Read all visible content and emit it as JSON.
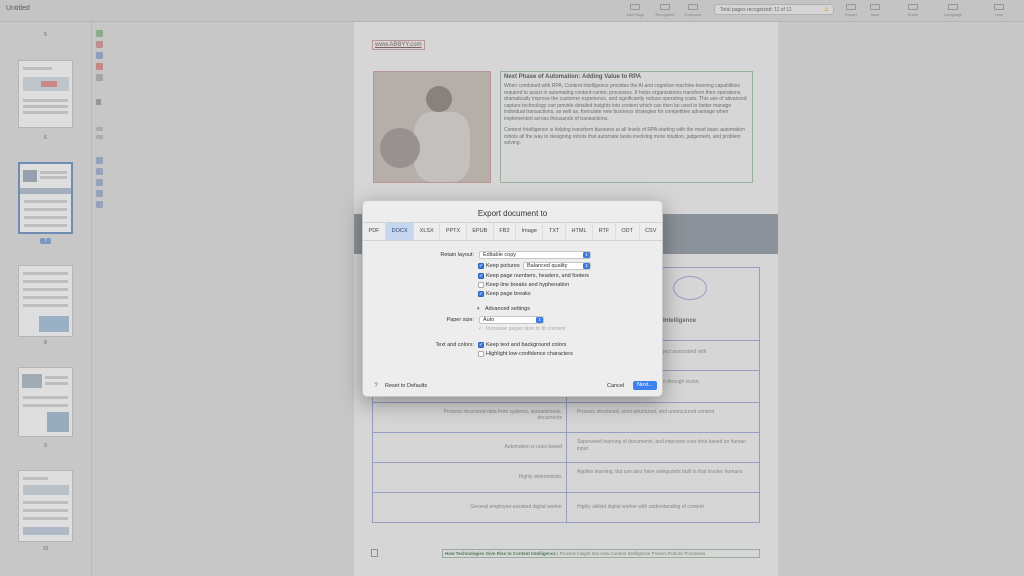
{
  "window": {
    "title": "Untitled",
    "status": "Total pages recognized: 11 of 11",
    "status_icon": "warning-icon"
  },
  "toolbar": {
    "buttons": [
      "Add Page",
      "Recognize",
      "Compare",
      "Export",
      "Save",
      "Share",
      "Language",
      "OCR Editor",
      "Help"
    ]
  },
  "sidebar": {
    "pages": [
      "5",
      "6",
      "7",
      "8",
      "9",
      "10"
    ],
    "selected_page": "7"
  },
  "document": {
    "url": "www.ABBYY.com",
    "heading": "Next Phase of Automation: Adding Value to RPA",
    "paragraph1": "When combined with RPA, Content Intelligence provides the AI and cognitive machine-learning capabilities required to assist in automating content-centric processes. It helps organizations transform their operations, dramatically improve the customer experience, and significantly reduce operating costs. This use of advanced capture technology can provide detailed insights into content which can then be used to better manage individual transactions, as well as, formulate new business strategies for competitive advantage when implemented across thousands of transactions.",
    "paragraph2": "Content Intelligence is helping transform business at all levels of RPA starting with the most basic automation robots all the way to designing robots that automate tasks involving more intuition, judgement, and problem solving.",
    "table": {
      "right_header": "Intelligence",
      "rows": [
        {
          "left": "",
          "right": "...ject associated with"
        },
        {
          "left": "",
          "right": "...n through vision,"
        },
        {
          "left": "Process structured data from systems, spreadsheets, documents",
          "right": "Process structured, semi-structured, and unstructured content"
        },
        {
          "left": "Automation is rules based",
          "right": "Supervised learning of documents, and improves over time based on human input"
        },
        {
          "left": "Highly deterministic",
          "right": "Applies learning, but can also have safeguards built in that involve humans"
        },
        {
          "left": "General employee-assisted digital worker",
          "right": "Highly skilled digital worker with understanding of content"
        }
      ]
    },
    "footer_bold": "How Technologies Give Rise to Content Intelligence",
    "footer_rest": " | Process Insight Into How Content Intelligence Powers Robotic Processes"
  },
  "dialog": {
    "title": "Export document to",
    "tabs": [
      "PDF",
      "DOCX",
      "XLSX",
      "PPTX",
      "EPUB",
      "FB2",
      "Image",
      "TXT",
      "HTML",
      "RTF",
      "ODT",
      "CSV"
    ],
    "active_tab": "DOCX",
    "retain_layout_label": "Retain layout:",
    "retain_layout_value": "Editable copy",
    "keep_pictures_label": "Keep pictures",
    "keep_pictures_checked": true,
    "picture_quality_value": "Balanced quality",
    "keep_headers_label": "Keep page numbers, headers, and footers",
    "keep_headers_checked": true,
    "keep_line_breaks_label": "Keep line breaks and hyphenation",
    "keep_line_breaks_checked": false,
    "keep_page_breaks_label": "Keep page breaks",
    "keep_page_breaks_checked": true,
    "advanced_label": "Advanced settings",
    "paper_size_label": "Paper size:",
    "paper_size_value": "Auto",
    "increase_paper_label": "Increase paper size to fit content",
    "text_colors_label": "Text and colors:",
    "keep_colors_label": "Keep text and background colors",
    "keep_colors_checked": true,
    "highlight_label": "Highlight low-confidence characters",
    "highlight_checked": false,
    "help_label": "?",
    "reset_label": "Reset to Defaults",
    "cancel_label": "Cancel",
    "next_label": "Next..."
  }
}
